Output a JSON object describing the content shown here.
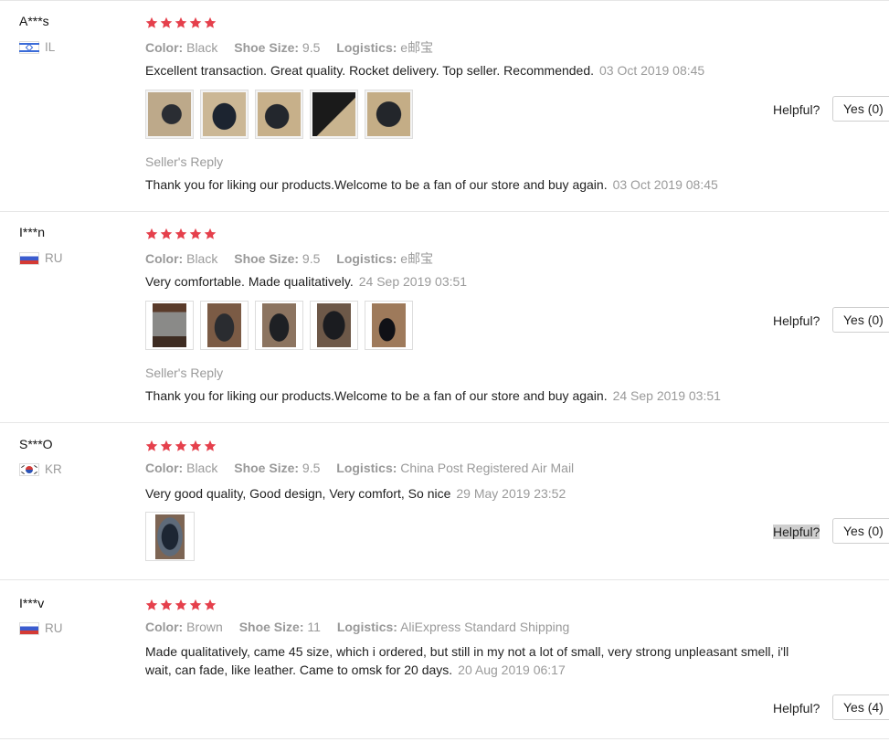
{
  "colors": {
    "star": "#e5404c",
    "muted": "#9a9a9a",
    "text": "#222222",
    "divider": "#e6e6e6"
  },
  "reviews": [
    {
      "user": "A***s",
      "country": "IL",
      "rating": 5,
      "meta": [
        {
          "key": "Color:",
          "value": "Black"
        },
        {
          "key": "Shoe Size:",
          "value": "9.5"
        },
        {
          "key": "Logistics:",
          "value": "e邮宝"
        }
      ],
      "text": "Excellent transaction. Great quality. Rocket delivery. Top seller. Recommended.",
      "date": "03 Oct 2019 08:45",
      "photos": 5,
      "reply_label": "Seller's Reply",
      "reply_text": "Thank you for liking our products.Welcome to be a fan of our store and buy again.",
      "reply_date": "03 Oct 2019 08:45",
      "helpful_label": "Helpful?",
      "yes_label": "Yes (0)"
    },
    {
      "user": "I***n",
      "country": "RU",
      "rating": 5,
      "meta": [
        {
          "key": "Color:",
          "value": "Black"
        },
        {
          "key": "Shoe Size:",
          "value": "9.5"
        },
        {
          "key": "Logistics:",
          "value": "e邮宝"
        }
      ],
      "text": "Very comfortable. Made qualitatively.",
      "date": "24 Sep 2019 03:51",
      "photos": 5,
      "reply_label": "Seller's Reply",
      "reply_text": "Thank you for liking our products.Welcome to be a fan of our store and buy again.",
      "reply_date": "24 Sep 2019 03:51",
      "helpful_label": "Helpful?",
      "yes_label": "Yes (0)"
    },
    {
      "user": "S***O",
      "country": "KR",
      "rating": 5,
      "meta": [
        {
          "key": "Color:",
          "value": "Black"
        },
        {
          "key": "Shoe Size:",
          "value": "9.5"
        },
        {
          "key": "Logistics:",
          "value": "China Post Registered Air Mail"
        }
      ],
      "text": "Very good quality, Good design, Very comfort, So nice",
      "date": "29 May 2019 23:52",
      "photos": 1,
      "helpful_label": "Helpful?",
      "yes_label": "Yes (0)"
    },
    {
      "user": "I***v",
      "country": "RU",
      "rating": 5,
      "meta": [
        {
          "key": "Color:",
          "value": "Brown"
        },
        {
          "key": "Shoe Size:",
          "value": "11"
        },
        {
          "key": "Logistics:",
          "value": "AliExpress Standard Shipping"
        }
      ],
      "text_line1": "Made qualitatively, came 45 size, which i ordered, but still in my not a lot of small, very strong unpleasant smell, i'll",
      "text_line2": "wait, can fade, like leather. Came to omsk for 20 days.",
      "date": "20 Aug 2019 06:17",
      "helpful_label": "Helpful?",
      "yes_label": "Yes (4)"
    }
  ]
}
